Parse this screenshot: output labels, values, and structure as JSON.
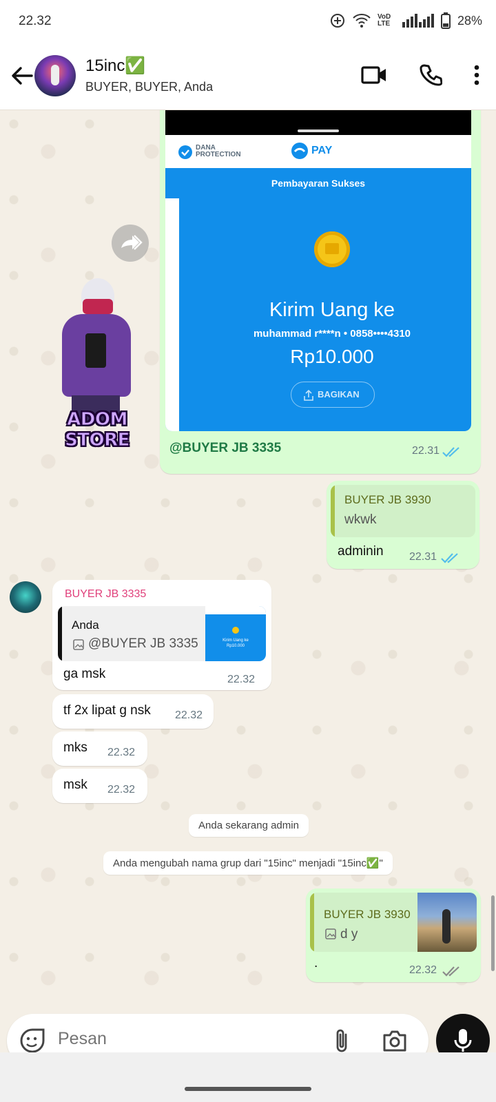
{
  "status_bar": {
    "time": "22.32",
    "network_label": "VoD LTE",
    "battery": "28%"
  },
  "header": {
    "title": "15inc✅",
    "subtitle": "BUYER, BUYER, Anda"
  },
  "messages": {
    "dana_receipt": {
      "brand_protection": "DANA PROTECTION",
      "brand_pay": "PAY",
      "header_text": "Pembayaran Sukses",
      "title": "Kirim Uang ke",
      "recipient": "muhammad r****n • 0858••••4310",
      "amount": "Rp10.000",
      "share_label": "BAGIKAN",
      "caption": "@BUYER JB 3335",
      "time": "22.31"
    },
    "sticker": {
      "text": "ADOM STORE"
    },
    "reply_adminin": {
      "quote_author": "BUYER JB 3930",
      "quote_text": "wkwk",
      "text": "adminin",
      "time": "22.31"
    },
    "incoming_group": {
      "author": "BUYER JB 3335",
      "quote_author": "Anda",
      "quote_text": "@BUYER JB 3335",
      "thumb_text": "Kirim Uang ke Rp10.000",
      "text": "ga msk",
      "time": "22.32"
    },
    "incoming_2": {
      "text": "tf 2x lipat g nsk",
      "time": "22.32"
    },
    "incoming_3": {
      "text": "mks",
      "time": "22.32"
    },
    "incoming_4": {
      "text": "msk",
      "time": "22.32"
    },
    "system_1": "Anda sekarang admin",
    "system_2": "Anda mengubah nama grup dari \"15inc\" menjadi \"15inc✅\"",
    "reply_dot": {
      "quote_author": "BUYER JB 3930",
      "quote_text": "d y",
      "text": ".",
      "time": "22.32"
    }
  },
  "input": {
    "placeholder": "Pesan"
  },
  "colors": {
    "outgoing_bubble": "#d9fdd3",
    "incoming_author": "#e0407b",
    "read_ticks": "#53bdeb",
    "dana_blue": "#118eea",
    "caption_green": "#1f7a45"
  }
}
